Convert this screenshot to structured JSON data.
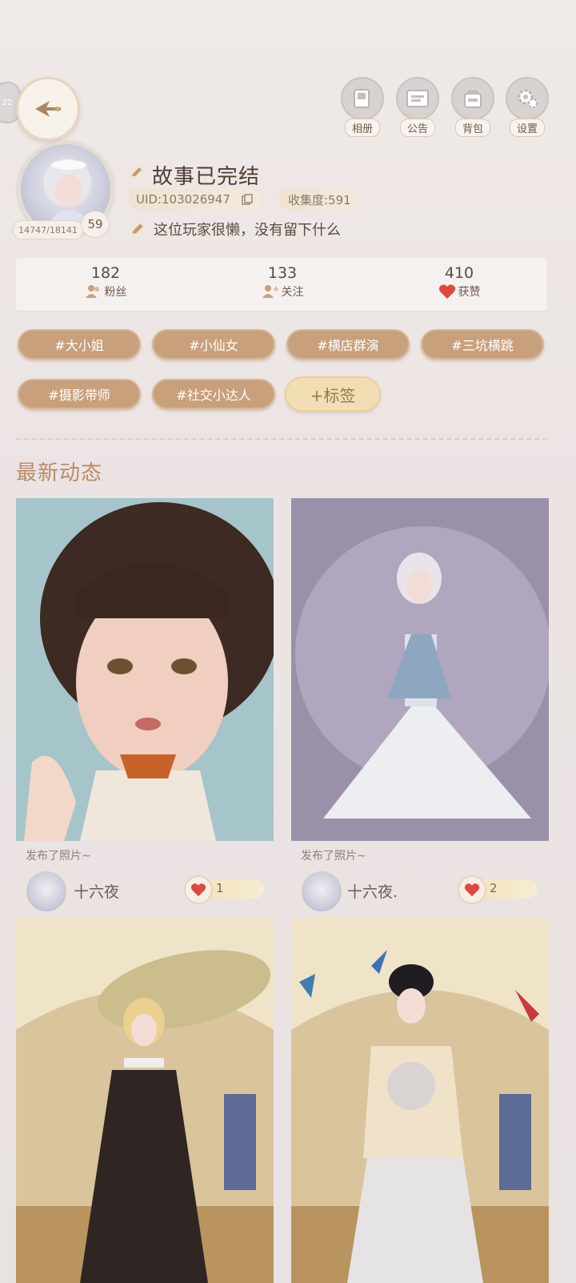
{
  "nav": {
    "side_tag": "22"
  },
  "top_icons": [
    {
      "label": "相册",
      "icon": "album-icon"
    },
    {
      "label": "公告",
      "icon": "notice-icon"
    },
    {
      "label": "背包",
      "icon": "bag-icon"
    },
    {
      "label": "设置",
      "icon": "settings-icon"
    }
  ],
  "profile": {
    "name": "故事已完结",
    "uid": "UID:103026947",
    "collection": "收集度:591",
    "bio": "这位玩家很懒，没有留下什么",
    "exp": "14747/18141",
    "level": "59"
  },
  "stats": [
    {
      "value": "182",
      "label": "粉丝"
    },
    {
      "value": "133",
      "label": "关注"
    },
    {
      "value": "410",
      "label": "获赞"
    }
  ],
  "tags": [
    "#大小姐",
    "#小仙女",
    "#横店群演",
    "#三坑横跳",
    "#摄影带师",
    "#社交小达人"
  ],
  "add_tag": "+标签",
  "section_title": "最新动态",
  "posts": [
    {
      "caption": "发布了照片~",
      "user": "十六夜",
      "likes": "1"
    },
    {
      "caption": "发布了照片~",
      "user": "十六夜.",
      "likes": "2"
    }
  ],
  "colors": {
    "accent": "#c8a07b",
    "title": "#b98a66",
    "heart": "#e2473f"
  }
}
